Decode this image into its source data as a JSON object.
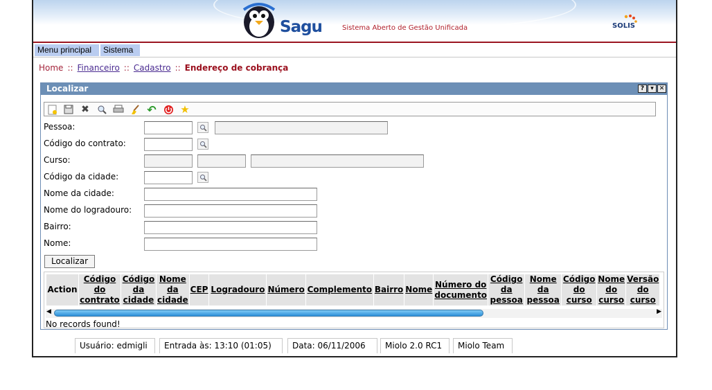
{
  "banner": {
    "brand": "Sagu",
    "tagline": "Sistema Aberto de Gestão Unificada",
    "partner_logo": "SOLIS"
  },
  "menu": {
    "items": [
      "Menu principal",
      "Sistema"
    ]
  },
  "breadcrumb": {
    "home": "Home",
    "sep": "::",
    "level1": "Financeiro",
    "level2": "Cadastro",
    "current": "Endereço de cobrança"
  },
  "window": {
    "title": "Localizar",
    "help": "?",
    "min": "▾",
    "close": "✕"
  },
  "toolbar": {
    "icons": [
      "new-icon",
      "save-icon",
      "delete-icon",
      "search-icon",
      "print-icon",
      "clear-icon",
      "back-icon",
      "exit-icon",
      "favorite-icon"
    ]
  },
  "form": {
    "pessoa": "Pessoa:",
    "contrato": "Código do contrato:",
    "curso": "Curso:",
    "cidade_codigo": "Código da cidade:",
    "cidade_nome": "Nome da cidade:",
    "logradouro": "Nome do logradouro:",
    "bairro": "Bairro:",
    "nome": "Nome:",
    "submit": "Localizar"
  },
  "grid": {
    "columns": [
      {
        "label": "Action",
        "link": false
      },
      {
        "label": "Código do contrato",
        "link": true
      },
      {
        "label": "Código da cidade",
        "link": true
      },
      {
        "label": "Nome da cidade",
        "link": true
      },
      {
        "label": "CEP",
        "link": true
      },
      {
        "label": "Logradouro",
        "link": true
      },
      {
        "label": "Número",
        "link": true
      },
      {
        "label": "Complemento",
        "link": true
      },
      {
        "label": "Bairro",
        "link": true
      },
      {
        "label": "Nome",
        "link": true
      },
      {
        "label": "Número do documento",
        "link": true
      },
      {
        "label": "Código da pessoa",
        "link": true
      },
      {
        "label": "Nome da pessoa",
        "link": true
      },
      {
        "label": "Código do curso",
        "link": true
      },
      {
        "label": "Nome do curso",
        "link": true
      },
      {
        "label": "Versão do curso",
        "link": true
      }
    ],
    "empty_message": "No records found!"
  },
  "status": {
    "user": "Usuário: edmigli",
    "login": "Entrada às: 13:10 (01:05)",
    "date": "Data: 06/11/2006",
    "version": "Miolo 2.0 RC1",
    "team": "Miolo Team"
  }
}
